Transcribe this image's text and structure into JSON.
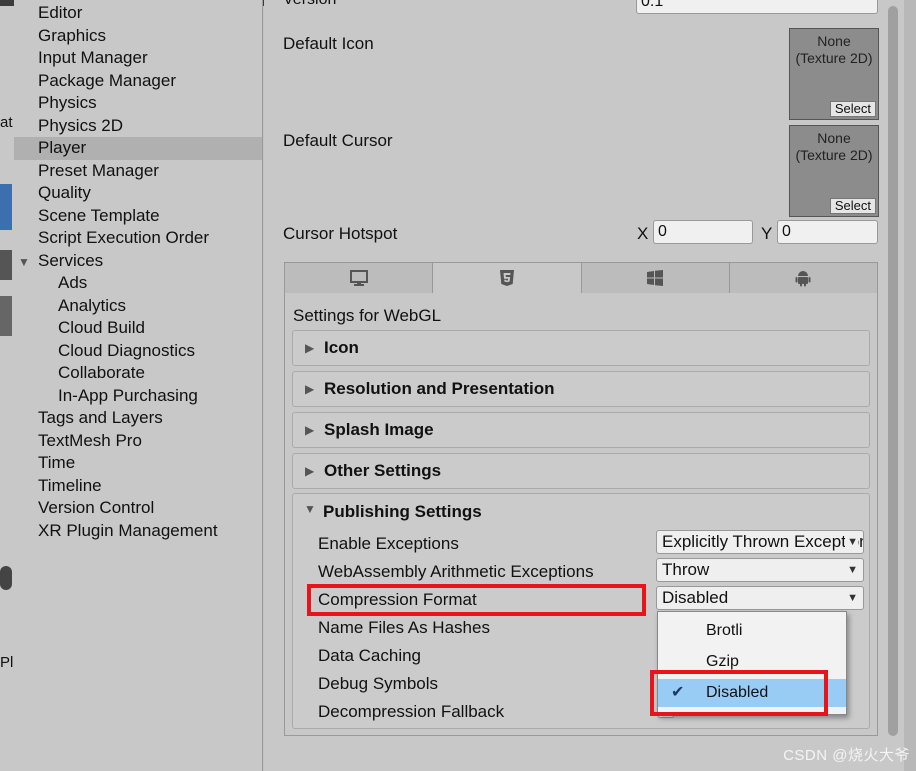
{
  "sidebar": {
    "items": [
      {
        "label": "Editor"
      },
      {
        "label": "Graphics"
      },
      {
        "label": "Input Manager"
      },
      {
        "label": "Package Manager"
      },
      {
        "label": "Physics"
      },
      {
        "label": "Physics 2D"
      },
      {
        "label": "Player"
      },
      {
        "label": "Preset Manager"
      },
      {
        "label": "Quality"
      },
      {
        "label": "Scene Template"
      },
      {
        "label": "Script Execution Order"
      },
      {
        "label": "Services"
      },
      {
        "label": "Ads"
      },
      {
        "label": "Analytics"
      },
      {
        "label": "Cloud Build"
      },
      {
        "label": "Cloud Diagnostics"
      },
      {
        "label": "Collaborate"
      },
      {
        "label": "In-App Purchasing"
      },
      {
        "label": "Tags and Layers"
      },
      {
        "label": "TextMesh Pro"
      },
      {
        "label": "Time"
      },
      {
        "label": "Timeline"
      },
      {
        "label": "Version Control"
      },
      {
        "label": "XR Plugin Management"
      }
    ],
    "selected": "Player"
  },
  "edge": {
    "frag1": "at",
    "frag2": "Pla"
  },
  "top": {
    "version_label": "Version",
    "version_value": "0.1",
    "default_icon_label": "Default Icon",
    "default_cursor_label": "Default Cursor",
    "texture_none": "None",
    "texture_type": "(Texture 2D)",
    "select_label": "Select",
    "cursor_hotspot_label": "Cursor Hotspot",
    "x_label": "X",
    "x_value": "0",
    "y_label": "Y",
    "y_value": "0"
  },
  "platform_tabs": [
    {
      "icon": "monitor-icon"
    },
    {
      "icon": "html5-icon"
    },
    {
      "icon": "windows-icon"
    },
    {
      "icon": "android-icon"
    }
  ],
  "settings_for": "Settings for WebGL",
  "foldouts": [
    {
      "title": "Icon"
    },
    {
      "title": "Resolution and Presentation"
    },
    {
      "title": "Splash Image"
    },
    {
      "title": "Other Settings"
    }
  ],
  "publishing": {
    "title": "Publishing Settings",
    "enable_exceptions_label": "Enable Exceptions",
    "enable_exceptions_value": "Explicitly Thrown Exceptions Only",
    "wasm_arith_label": "WebAssembly Arithmetic Exceptions",
    "wasm_arith_value": "Throw",
    "compression_label": "Compression Format",
    "compression_value": "Disabled",
    "name_files_label": "Name Files As Hashes",
    "data_caching_label": "Data Caching",
    "debug_symbols_label": "Debug Symbols",
    "decompression_label": "Decompression Fallback"
  },
  "popup": {
    "options": [
      "Brotli",
      "Gzip",
      "Disabled"
    ],
    "checked": "Disabled"
  },
  "watermark": "CSDN @烧火大爷",
  "colors": {
    "highlight": "#e8141c",
    "selection": "#99ccf5"
  }
}
